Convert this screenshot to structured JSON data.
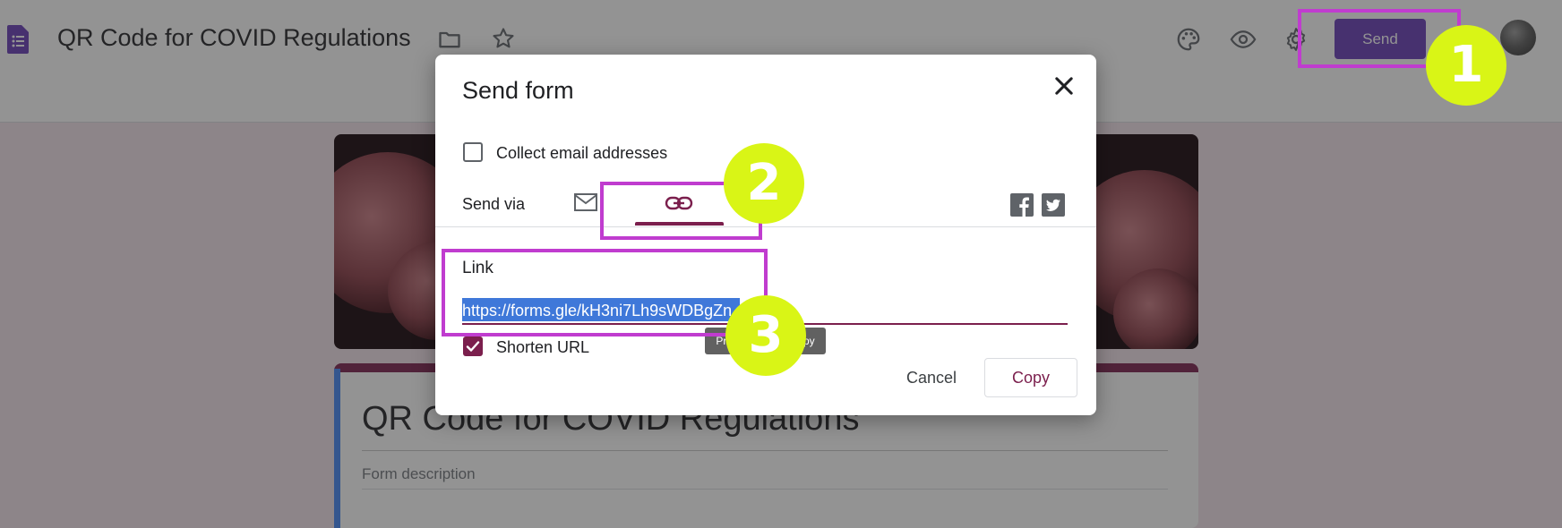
{
  "app": {
    "title": "QR Code for COVID Regulations",
    "send_label": "Send",
    "icons": [
      "forms-doc-icon",
      "folder-icon",
      "star-icon",
      "palette-icon",
      "eye-icon",
      "gear-icon",
      "avatar"
    ]
  },
  "form": {
    "title": "QR Code for COVID Regulations",
    "description_placeholder": "Form description",
    "accent_color": "#7b1f4d"
  },
  "dialog": {
    "title": "Send form",
    "collect_email_label": "Collect email addresses",
    "collect_email_checked": false,
    "send_via_label": "Send via",
    "send_via_tabs": [
      "email-icon",
      "link-icon"
    ],
    "active_tab": "link",
    "social_icons": [
      "facebook-icon",
      "twitter-icon"
    ],
    "link_label": "Link",
    "link_value": "https://forms.gle/kH3ni7Lh9sWDBgZn",
    "link_visible_text": "https://forms.gle/kH3ni7Lh9sWDBgZn",
    "tooltip": "Press Ctrl+C to copy",
    "shorten_url_label": "Shorten URL",
    "shorten_url_checked": true,
    "cancel_label": "Cancel",
    "copy_label": "Copy"
  },
  "overlay": {
    "step_1": "1",
    "step_2": "2",
    "step_3": "3",
    "highlight_color": "#c03ccf",
    "badge_color": "#d9f516"
  }
}
